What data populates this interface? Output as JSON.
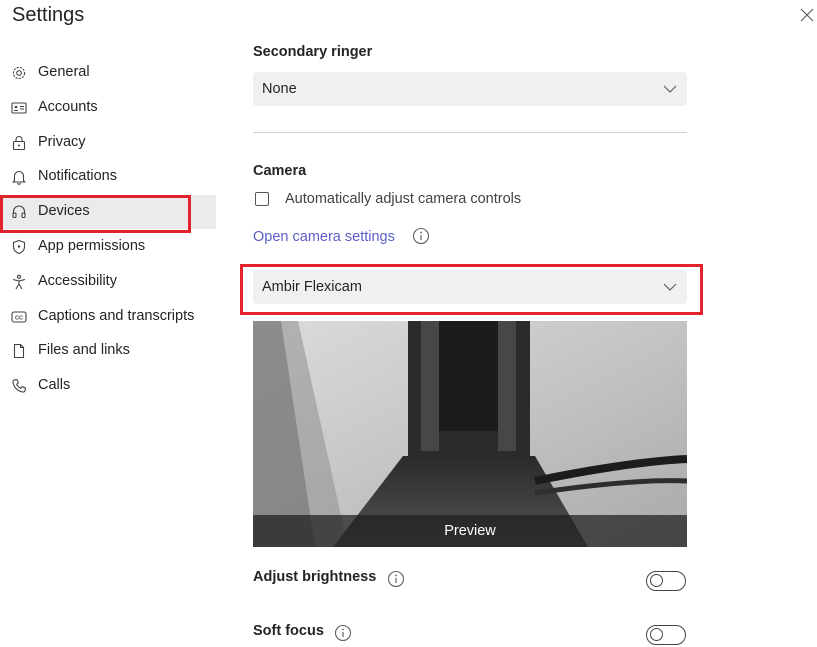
{
  "window": {
    "title": "Settings",
    "close_icon": "close-icon"
  },
  "sidebar": {
    "items": [
      {
        "label": "General",
        "icon": "gear-icon"
      },
      {
        "label": "Accounts",
        "icon": "id-card-icon"
      },
      {
        "label": "Privacy",
        "icon": "lock-icon"
      },
      {
        "label": "Notifications",
        "icon": "bell-icon"
      },
      {
        "label": "Devices",
        "icon": "headset-icon",
        "selected": true
      },
      {
        "label": "App permissions",
        "icon": "shield-icon"
      },
      {
        "label": "Accessibility",
        "icon": "accessibility-icon"
      },
      {
        "label": "Captions and transcripts",
        "icon": "closed-captions-icon"
      },
      {
        "label": "Files and links",
        "icon": "document-icon"
      },
      {
        "label": "Calls",
        "icon": "phone-icon"
      }
    ]
  },
  "main": {
    "secondary_ringer": {
      "heading": "Secondary ringer",
      "value": "None"
    },
    "camera": {
      "heading": "Camera",
      "auto_adjust_label": "Automatically adjust camera controls",
      "auto_adjust_checked": false,
      "settings_link": "Open camera settings",
      "device_value": "Ambir Flexicam",
      "preview_label": "Preview"
    },
    "adjust_brightness": {
      "label": "Adjust brightness",
      "enabled": false
    },
    "soft_focus": {
      "label": "Soft focus",
      "enabled": false
    }
  },
  "colors": {
    "highlight": "#e0242b",
    "link": "#5b5fc7",
    "selected_bg": "#ebebeb"
  }
}
